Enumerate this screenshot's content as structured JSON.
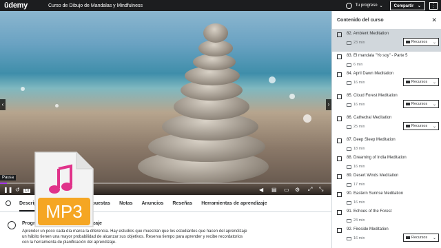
{
  "header": {
    "logo": "ûdemy",
    "course_title": "Curso de Dibujo de Mandalas y Mindfulness",
    "progress_label": "Tu progreso",
    "progress_chevron": "⌄",
    "share_label": "Compartir",
    "share_chevron": "⌄",
    "more_label": "⋮"
  },
  "player": {
    "tooltip": "Pausa",
    "progress_fraction": 0.02,
    "speed_label": "1x",
    "prev_arrow": "‹",
    "next_arrow": "›"
  },
  "tabs": [
    "Descripción",
    "Preguntas y respuestas",
    "Notas",
    "Anuncios",
    "Reseñas",
    "Herramientas de aprendizaje"
  ],
  "reminder": {
    "title": "Programa el tiempo de aprendizaje",
    "text": "Aprender un poco cada día marca la diferencia. Hay estudios que muestran que los estudiantes que hacen del aprendizaje un hábito tienen una mayor probabilidad de alcanzar sus objetivos. Reserva tiempo para aprender y recibe recordatorios con la herramienta de planificación del aprendizaje."
  },
  "overlay": {
    "badge": "MP3",
    "badge_color": "#f5a623"
  },
  "sidebar": {
    "title": "Contenido del curso",
    "close": "✕",
    "resources_label": "Recursos",
    "resources_chevron": "⌄",
    "lessons": [
      {
        "title": "82. Ambient Meditation",
        "duration": "23 min",
        "resources": true,
        "current": true
      },
      {
        "title": "83. El mandala \"Yo soy\" - Parte 5",
        "duration": "6 min",
        "resources": false
      },
      {
        "title": "84. April Dawn Meditation",
        "duration": "16 min",
        "resources": true
      },
      {
        "title": "85. Cloud Forest Meditation",
        "duration": "16 min",
        "resources": true
      },
      {
        "title": "86. Cathedral Meditation",
        "duration": "25 min",
        "resources": true
      },
      {
        "title": "87. Deep Sleep Meditation",
        "duration": "18 min",
        "resources": false
      },
      {
        "title": "88. Dreaming of India Meditation",
        "duration": "16 min",
        "resources": false
      },
      {
        "title": "89. Desert Winds Meditation",
        "duration": "17 min",
        "resources": false
      },
      {
        "title": "90. Eastern Sunrise Meditation",
        "duration": "16 min",
        "resources": false
      },
      {
        "title": "91. Echoes of the Forest",
        "duration": "24 min",
        "resources": false
      },
      {
        "title": "92. Fireside Meditation",
        "duration": "16 min",
        "resources": true
      }
    ]
  }
}
